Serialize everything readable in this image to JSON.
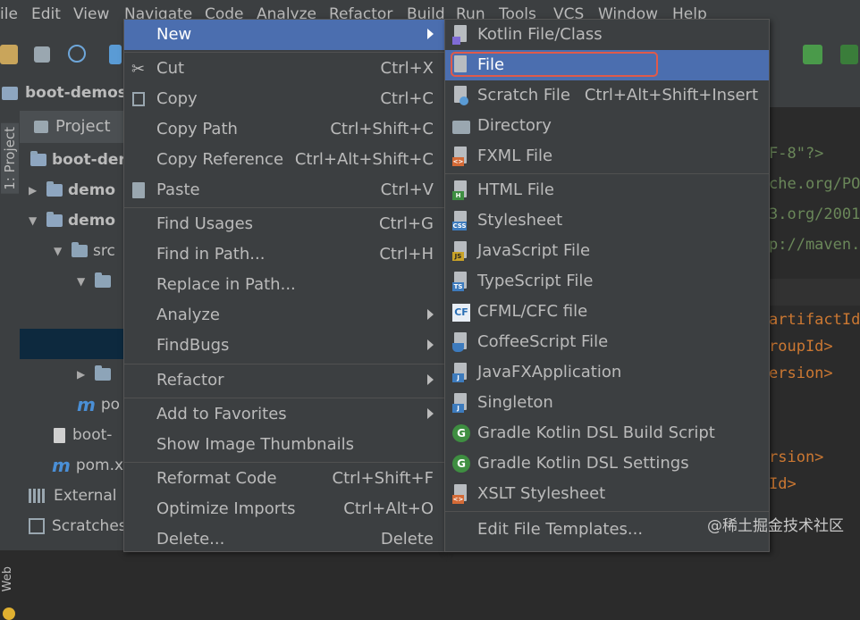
{
  "menubar": {
    "items": [
      "ile",
      "Edit",
      "View",
      "Navigate",
      "Code",
      "Analyze",
      "Refactor",
      "Build",
      "Run",
      "Tools",
      "VCS",
      "Window",
      "Help"
    ]
  },
  "navbar": {
    "project": "boot-demos"
  },
  "stripe": {
    "project_tab": "1: Project",
    "web_tab": "Web"
  },
  "project_panel": {
    "header": "Project",
    "rows": [
      "boot-der",
      "demo",
      "demo",
      "src",
      "",
      "",
      "po",
      "boot-",
      "pom.x",
      "External",
      "Scratches"
    ]
  },
  "editor": {
    "lines": [
      "F-8\"?>",
      "che.org/PO",
      "3.org/2001",
      "p://maven.",
      "artifactId",
      "roupId>",
      "ersion>",
      "rsion>",
      "Id>"
    ]
  },
  "context_menu": {
    "items": [
      {
        "label": "New",
        "shortcut": "",
        "submenu": true
      },
      {
        "label": "Cut",
        "shortcut": "Ctrl+X"
      },
      {
        "label": "Copy",
        "shortcut": "Ctrl+C"
      },
      {
        "label": "Copy Path",
        "shortcut": "Ctrl+Shift+C"
      },
      {
        "label": "Copy Reference",
        "shortcut": "Ctrl+Alt+Shift+C"
      },
      {
        "label": "Paste",
        "shortcut": "Ctrl+V"
      },
      {
        "label": "Find Usages",
        "shortcut": "Ctrl+G"
      },
      {
        "label": "Find in Path...",
        "shortcut": "Ctrl+H"
      },
      {
        "label": "Replace in Path...",
        "shortcut": ""
      },
      {
        "label": "Analyze",
        "shortcut": "",
        "submenu": true
      },
      {
        "label": "FindBugs",
        "shortcut": "",
        "submenu": true
      },
      {
        "label": "Refactor",
        "shortcut": "",
        "submenu": true
      },
      {
        "label": "Add to Favorites",
        "shortcut": "",
        "submenu": true
      },
      {
        "label": "Show Image Thumbnails",
        "shortcut": ""
      },
      {
        "label": "Reformat Code",
        "shortcut": "Ctrl+Shift+F"
      },
      {
        "label": "Optimize Imports",
        "shortcut": "Ctrl+Alt+O"
      },
      {
        "label": "Delete...",
        "shortcut": "Delete"
      }
    ]
  },
  "new_submenu": {
    "items": [
      {
        "label": "Kotlin File/Class",
        "shortcut": ""
      },
      {
        "label": "File",
        "shortcut": ""
      },
      {
        "label": "Scratch File",
        "shortcut": "Ctrl+Alt+Shift+Insert"
      },
      {
        "label": "Directory",
        "shortcut": ""
      },
      {
        "label": "FXML File",
        "shortcut": ""
      },
      {
        "label": "HTML File",
        "shortcut": ""
      },
      {
        "label": "Stylesheet",
        "shortcut": ""
      },
      {
        "label": "JavaScript File",
        "shortcut": ""
      },
      {
        "label": "TypeScript File",
        "shortcut": ""
      },
      {
        "label": "CFML/CFC file",
        "shortcut": ""
      },
      {
        "label": "CoffeeScript File",
        "shortcut": ""
      },
      {
        "label": "JavaFXApplication",
        "shortcut": ""
      },
      {
        "label": "Singleton",
        "shortcut": ""
      },
      {
        "label": "Gradle Kotlin DSL Build Script",
        "shortcut": ""
      },
      {
        "label": "Gradle Kotlin DSL Settings",
        "shortcut": ""
      },
      {
        "label": "XSLT Stylesheet",
        "shortcut": ""
      },
      {
        "label": "Edit File Templates...",
        "shortcut": ""
      }
    ],
    "badges": {
      "fxml": "<>",
      "html": "H",
      "css": "CSS",
      "js": "JS",
      "ts": "TS",
      "cf": "CF",
      "j": "J",
      "g": "G",
      "xslt": "<>"
    }
  },
  "watermark": "@稀土掘金技术社区",
  "colors": {
    "accent": "#4b6eaf",
    "highlight_border": "#e05a4a",
    "panel": "#3c3f41",
    "editor": "#2b2b2b",
    "code_orange": "#cc7832",
    "code_green": "#6a8759"
  }
}
